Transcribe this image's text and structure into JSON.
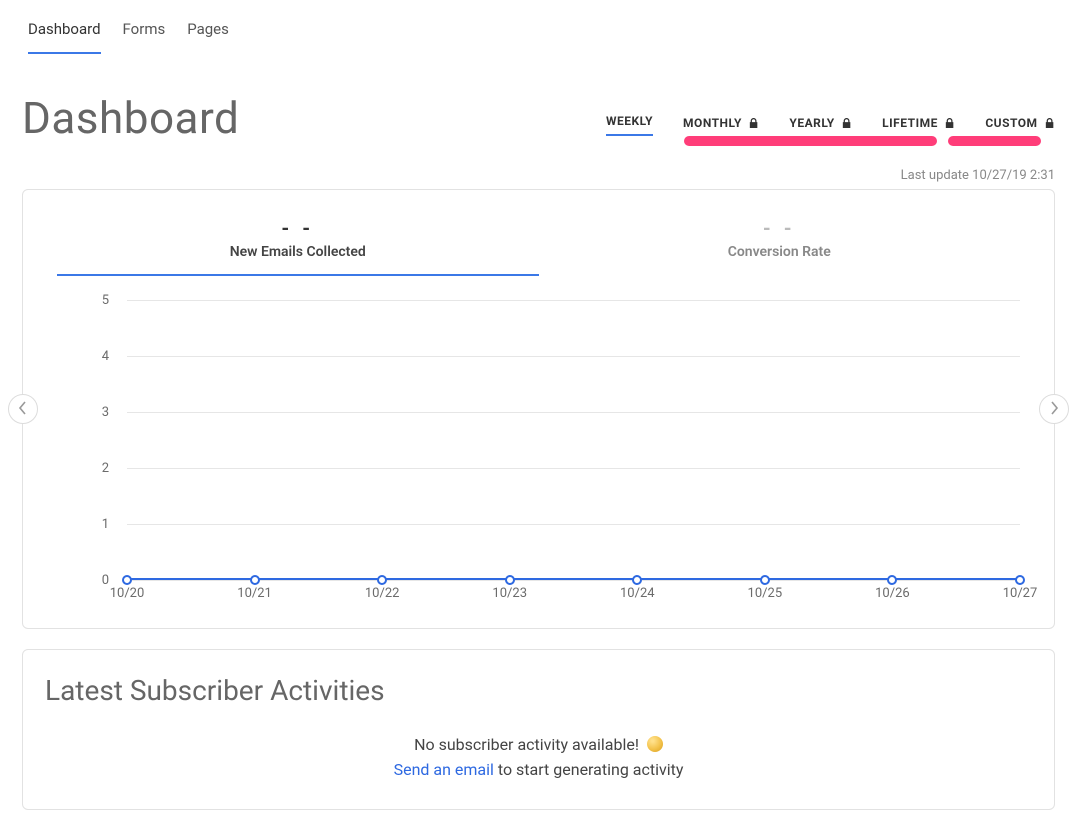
{
  "nav": {
    "items": [
      {
        "label": "Dashboard",
        "active": true
      },
      {
        "label": "Forms",
        "active": false
      },
      {
        "label": "Pages",
        "active": false
      }
    ]
  },
  "page_title": "Dashboard",
  "range_tabs": [
    {
      "label": "WEEKLY",
      "locked": false,
      "active": true
    },
    {
      "label": "MONTHLY",
      "locked": true,
      "active": false
    },
    {
      "label": "YEARLY",
      "locked": true,
      "active": false
    },
    {
      "label": "LIFETIME",
      "locked": true,
      "active": false
    },
    {
      "label": "CUSTOM",
      "locked": true,
      "active": false
    }
  ],
  "last_update": "Last update 10/27/19 2:31",
  "chart_tabs": [
    {
      "value": "- -",
      "label": "New Emails Collected",
      "active": true
    },
    {
      "value": "- -",
      "label": "Conversion Rate",
      "active": false
    }
  ],
  "chart_data": {
    "type": "line",
    "categories": [
      "10/20",
      "10/21",
      "10/22",
      "10/23",
      "10/24",
      "10/25",
      "10/26",
      "10/27"
    ],
    "values": [
      0,
      0,
      0,
      0,
      0,
      0,
      0,
      0
    ],
    "y_ticks": [
      5,
      4,
      3,
      2,
      1,
      0
    ],
    "title": "",
    "xlabel": "",
    "ylabel": "",
    "ylim": [
      0,
      5
    ]
  },
  "activities": {
    "title": "Latest Subscriber Activities",
    "empty_text": "No subscriber activity available!",
    "link_text": "Send an email",
    "suffix_text": " to start generating activity"
  },
  "colors": {
    "accent": "#3b78e7",
    "highlight": "#ff3d79"
  }
}
